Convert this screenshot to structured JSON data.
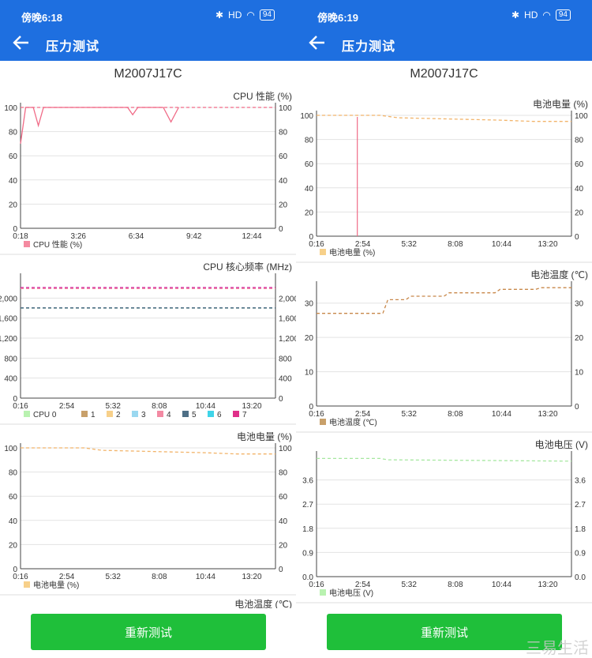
{
  "screens": [
    {
      "status": {
        "time": "傍晚6:18",
        "battery": "94",
        "network": "HD",
        "wechat": "◘"
      },
      "app_title": "压力测试",
      "device_title": "M2007J17C",
      "button_label": "重新测试",
      "peek_label": "电池温度 (℃)"
    },
    {
      "status": {
        "time": "傍晚6:19",
        "battery": "94",
        "network": "HD",
        "wechat": "◘"
      },
      "app_title": "压力测试",
      "device_title": "M2007J17C",
      "button_label": "重新测试"
    }
  ],
  "watermark": "三易生活",
  "colors": {
    "appbar": "#1e6fe0",
    "button": "#1fbf3a"
  },
  "chart_data": [
    {
      "id": "L1",
      "type": "line",
      "title": "CPU 性能 (%)",
      "x_ticks": [
        "0:18",
        "3:26",
        "6:34",
        "9:42",
        "12:44"
      ],
      "y_ticks": [
        0,
        20,
        40,
        60,
        80,
        100
      ],
      "ylim": [
        0,
        100
      ],
      "legend": [
        {
          "name": "CPU 性能 (%)",
          "color": "#f48aa0"
        }
      ],
      "series": [
        {
          "name": "CPU 性能 (%)",
          "color": "#f06a86",
          "dashed": false,
          "values": [
            [
              0.0,
              70
            ],
            [
              0.02,
              100
            ],
            [
              0.05,
              100
            ],
            [
              0.07,
              85
            ],
            [
              0.09,
              100
            ],
            [
              0.42,
              100
            ],
            [
              0.44,
              94
            ],
            [
              0.46,
              100
            ],
            [
              0.56,
              100
            ],
            [
              0.59,
              88
            ],
            [
              0.62,
              100
            ]
          ]
        },
        {
          "name": "CPU 性能 (%)",
          "color": "#f06a86",
          "dashed": true,
          "values": [
            [
              0.0,
              100
            ],
            [
              1.0,
              100
            ]
          ]
        }
      ]
    },
    {
      "id": "L2",
      "type": "line",
      "title": "CPU 核心频率 (MHz)",
      "x_ticks": [
        "0:16",
        "2:54",
        "5:32",
        "8:08",
        "10:44",
        "13:20"
      ],
      "y_ticks": [
        0,
        400,
        800,
        1200,
        1600,
        2000
      ],
      "y_tick_labels": [
        "0",
        "400",
        "800",
        "1,200",
        "1,600",
        "2,000"
      ],
      "ylim": [
        0,
        2400
      ],
      "legend": [
        {
          "name": "CPU 0",
          "color": "#b9f2b0"
        },
        {
          "name": "1",
          "color": "#c8a06a"
        },
        {
          "name": "2",
          "color": "#f7d08a"
        },
        {
          "name": "3",
          "color": "#9ad8f0"
        },
        {
          "name": "4",
          "color": "#f38aa3"
        },
        {
          "name": "5",
          "color": "#4e6f86"
        },
        {
          "name": "6",
          "color": "#3fd4e8"
        },
        {
          "name": "7",
          "color": "#e0308a"
        }
      ],
      "series": [
        {
          "name": "CPU 0",
          "color": "#3d7d6e",
          "dashed": true,
          "values": [
            [
              0,
              1800
            ],
            [
              1,
              1800
            ]
          ]
        },
        {
          "name": "5",
          "color": "#4e6f86",
          "dashed": true,
          "values": [
            [
              0,
              1805
            ],
            [
              1,
              1805
            ]
          ]
        },
        {
          "name": "4",
          "color": "#f38aa3",
          "dashed": true,
          "values": [
            [
              0,
              2190
            ],
            [
              1,
              2190
            ]
          ]
        },
        {
          "name": "7",
          "color": "#d0209a",
          "dashed": true,
          "values": [
            [
              0,
              2210
            ],
            [
              1,
              2210
            ]
          ]
        }
      ]
    },
    {
      "id": "L3",
      "type": "line",
      "title": "电池电量 (%)",
      "x_ticks": [
        "0:16",
        "2:54",
        "5:32",
        "8:08",
        "10:44",
        "13:20"
      ],
      "y_ticks": [
        0,
        20,
        40,
        60,
        80,
        100
      ],
      "ylim": [
        0,
        100
      ],
      "legend": [
        {
          "name": "电池电量 (%)",
          "color": "#f7d08a"
        }
      ],
      "series": [
        {
          "name": "电池电量 (%)",
          "color": "#f2b46a",
          "dashed": true,
          "values": [
            [
              0,
              100
            ],
            [
              0.25,
              100
            ],
            [
              0.32,
              98
            ],
            [
              0.52,
              97
            ],
            [
              0.72,
              96
            ],
            [
              0.85,
              95
            ],
            [
              1,
              95
            ]
          ]
        }
      ]
    },
    {
      "id": "R1",
      "type": "line",
      "title": "电池电量 (%)",
      "x_ticks": [
        "0:16",
        "2:54",
        "5:32",
        "8:08",
        "10:44",
        "13:20"
      ],
      "y_ticks": [
        0,
        20,
        40,
        60,
        80,
        100
      ],
      "ylim": [
        0,
        100
      ],
      "legend": [
        {
          "name": "电池电量 (%)",
          "color": "#f7d08a"
        }
      ],
      "vline": {
        "x": 0.16,
        "color": "#f06a86"
      },
      "series": [
        {
          "name": "电池电量 (%)",
          "color": "#f2b46a",
          "dashed": true,
          "values": [
            [
              0,
              100
            ],
            [
              0.25,
              100
            ],
            [
              0.32,
              98
            ],
            [
              0.52,
              97
            ],
            [
              0.72,
              96
            ],
            [
              0.85,
              95
            ],
            [
              1,
              95
            ]
          ]
        }
      ]
    },
    {
      "id": "R2",
      "type": "line",
      "title": "电池温度 (℃)",
      "x_ticks": [
        "0:16",
        "2:54",
        "5:32",
        "8:08",
        "10:44",
        "13:20"
      ],
      "y_ticks": [
        0,
        10,
        20,
        30
      ],
      "ylim": [
        0,
        35
      ],
      "legend": [
        {
          "name": "电池温度 (℃)",
          "color": "#c8a06a"
        }
      ],
      "series": [
        {
          "name": "电池温度 (℃)",
          "color": "#c8884a",
          "dashed": true,
          "values": [
            [
              0,
              27
            ],
            [
              0.26,
              27
            ],
            [
              0.28,
              31
            ],
            [
              0.35,
              31
            ],
            [
              0.37,
              32
            ],
            [
              0.5,
              32
            ],
            [
              0.52,
              33
            ],
            [
              0.7,
              33
            ],
            [
              0.72,
              34
            ],
            [
              0.86,
              34
            ],
            [
              0.88,
              34.5
            ],
            [
              1,
              34.5
            ]
          ]
        }
      ]
    },
    {
      "id": "R3",
      "type": "line",
      "title": "电池电压 (V)",
      "x_ticks": [
        "0:16",
        "2:54",
        "5:32",
        "8:08",
        "10:44",
        "13:20"
      ],
      "y_ticks": [
        0,
        0.9,
        1.8,
        2.7,
        3.6
      ],
      "y_tick_labels": [
        "0.0",
        "0.9",
        "1.8",
        "2.7",
        "3.6"
      ],
      "ylim": [
        0,
        4.5
      ],
      "legend": [
        {
          "name": "电池电压 (V)",
          "color": "#b9f2b0"
        }
      ],
      "series": [
        {
          "name": "电池电压 (V)",
          "color": "#a6e7a0",
          "dashed": true,
          "values": [
            [
              0,
              4.4
            ],
            [
              0.25,
              4.4
            ],
            [
              0.28,
              4.35
            ],
            [
              0.6,
              4.33
            ],
            [
              1,
              4.3
            ]
          ]
        }
      ]
    }
  ]
}
